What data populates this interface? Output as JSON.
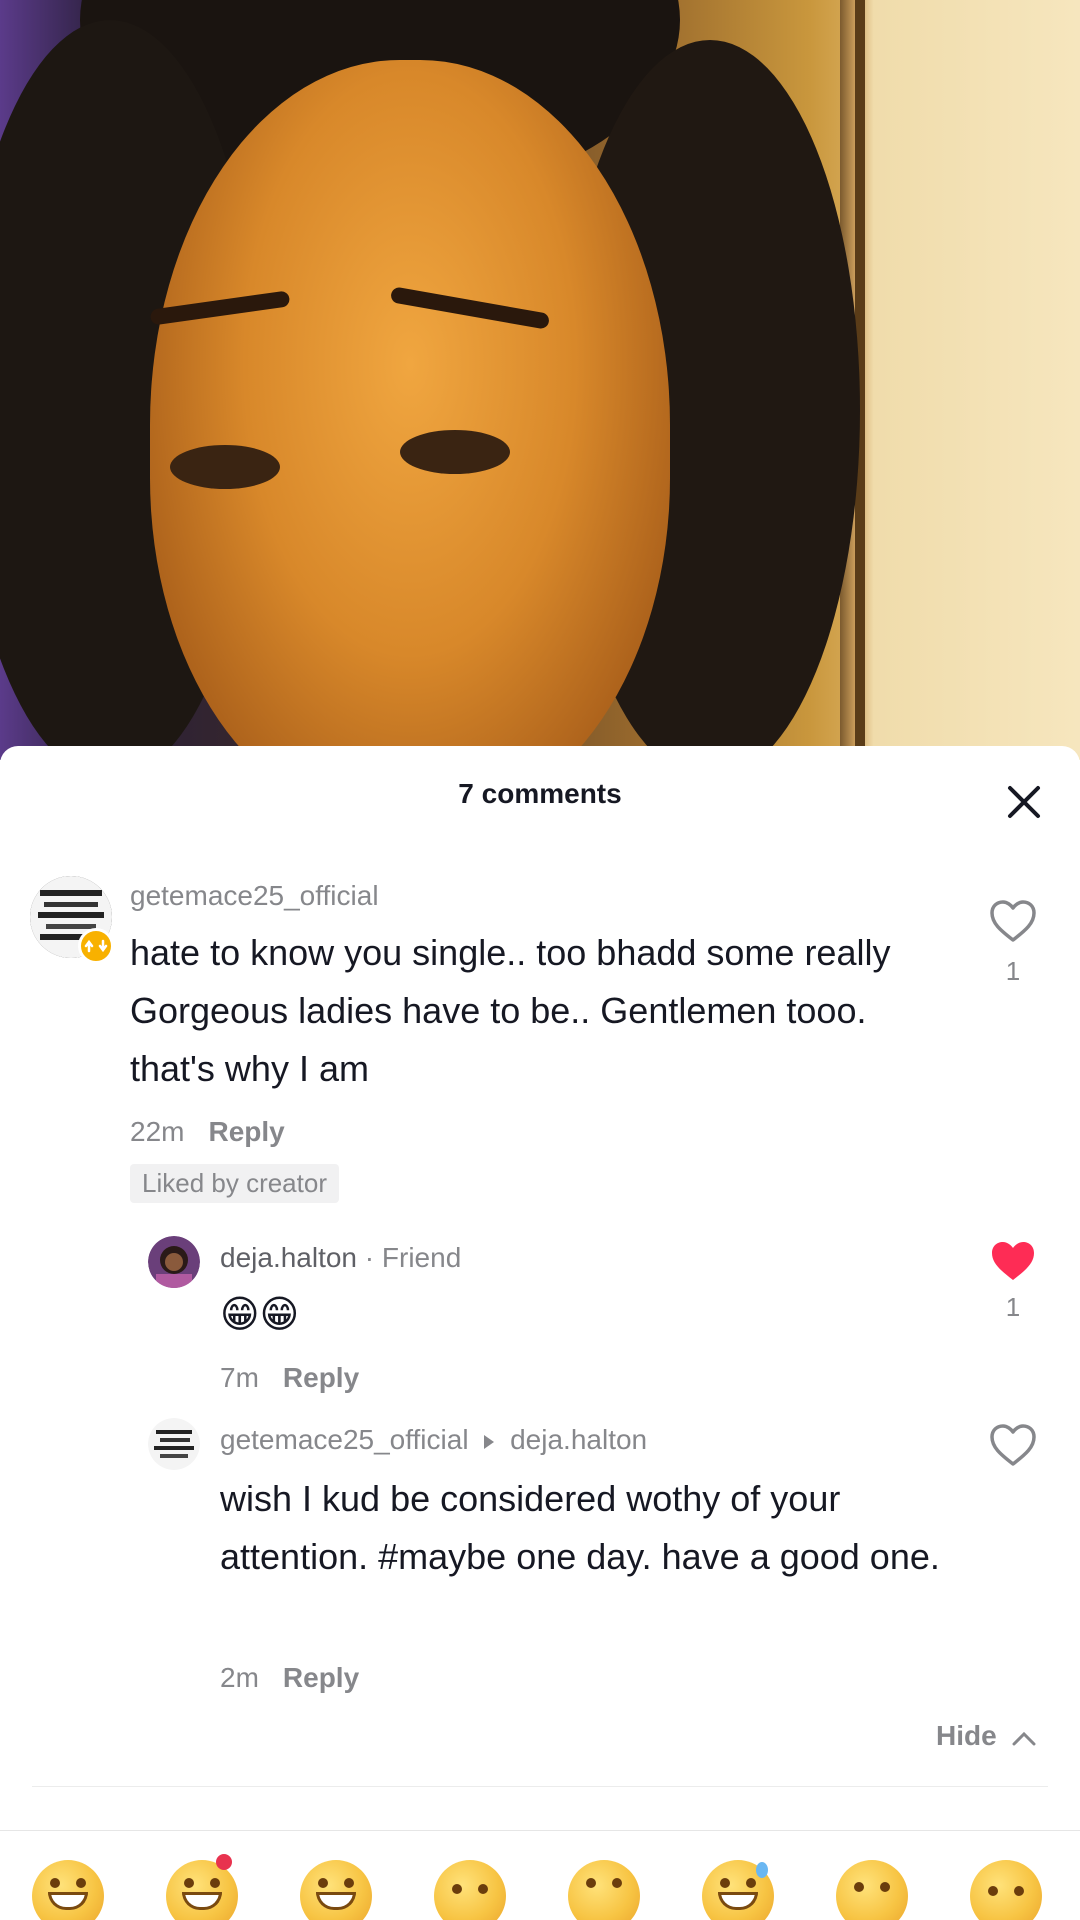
{
  "header": {
    "comment_count": "7 comments"
  },
  "comments": [
    {
      "username": "getemace25_official",
      "text": "hate to know you single.. too bhadd some really Gorgeous ladies have to be.. Gentlemen tooo. that's why I am",
      "time": "22m",
      "reply_label": "Reply",
      "badge": "Liked by creator",
      "likes": "1",
      "liked": false
    },
    {
      "username": "deja.halton",
      "tag": "· Friend",
      "text": "😁😁",
      "time": "7m",
      "reply_label": "Reply",
      "likes": "1",
      "liked": true
    },
    {
      "username": "getemace25_official",
      "reply_to": "deja.halton",
      "text": "wish I kud be considered wothy of your attention. #maybe one day. have a good one.",
      "time": "2m",
      "reply_label": "Reply",
      "liked": false
    }
  ],
  "hide_label": "Hide",
  "emojis": [
    "grinning-face",
    "smiling-face-with-hearts",
    "face-with-tears-of-joy",
    "flushed-face",
    "smirking-face",
    "grinning-face-with-sweat",
    "pleading-face",
    "relieved-face"
  ],
  "colors": {
    "like_active": "#fe2c55",
    "muted_text": "#86878b",
    "primary_text": "#161823"
  }
}
